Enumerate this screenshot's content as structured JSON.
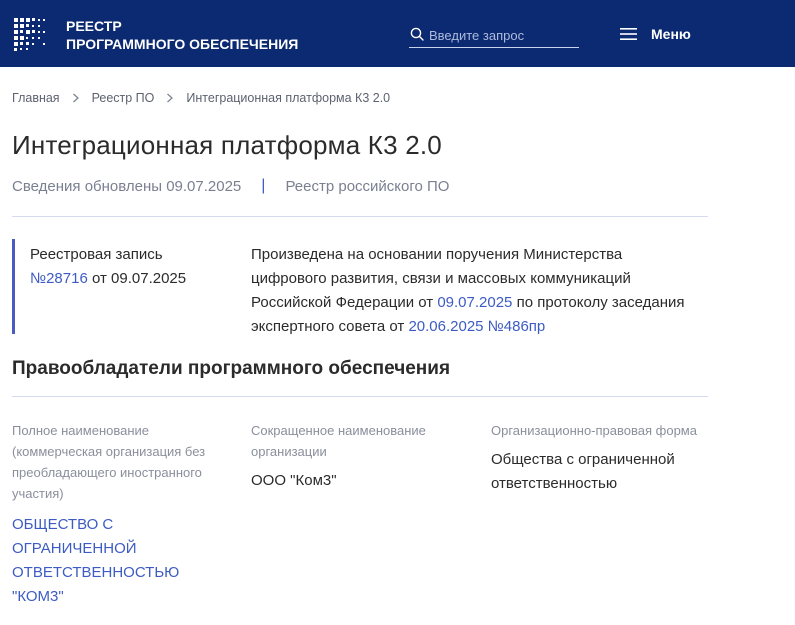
{
  "header": {
    "logo_line1": "РЕЕСТР",
    "logo_line2": "ПРОГРАММНОГО ОБЕСПЕЧЕНИЯ",
    "search_placeholder": "Введите запрос",
    "menu_label": "Меню",
    "bg_color": "#0b2a72"
  },
  "breadcrumb": [
    "Главная",
    "Реестр ПО",
    "Интеграционная платформа К3 2.0"
  ],
  "page": {
    "title": "Интеграционная платформа К3 2.0",
    "updated": "Сведения обновлены 09.07.2025",
    "divider": "|",
    "registry_link": "Реестр российского ПО"
  },
  "record": {
    "label": "Реестровая запись",
    "number": "№28716",
    "date_text": " от 09.07.2025",
    "desc_part1": "Произведена на основании поручения Министерства цифрового развития, связи и массовых коммуникаций Российской Федерации от ",
    "desc_date": "09.07.2025",
    "desc_part2": " по протоколу заседания экспертного совета от ",
    "desc_protocol": "20.06.2025 №486пр"
  },
  "owners": {
    "section_title": "Правообладатели программного обеспечения",
    "full_name_label": "Полное наименование (коммерческая организация без преобладающего иностранного участия)",
    "full_name_value": "ОБЩЕСТВО С ОГРАНИЧЕННОЙ ОТВЕТСТВЕННОСТЬЮ \"КОМ3\"",
    "short_name_label": "Сокращенное наименование организации",
    "short_name_value": "ООО \"Ком3\"",
    "legal_form_label": "Организационно-правовая форма",
    "legal_form_value": "Общества с ограниченной ответственностью"
  },
  "colors": {
    "accent": "#3d5bc4",
    "text": "#2b2b2b",
    "muted": "#7a8092"
  }
}
